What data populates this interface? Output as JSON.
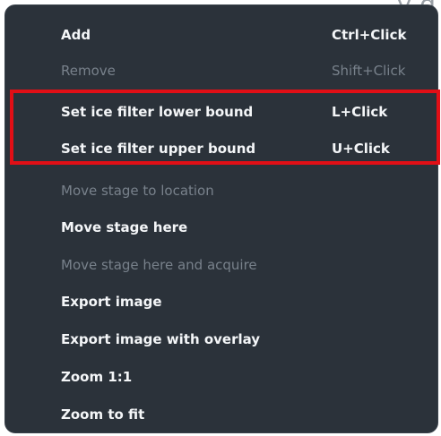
{
  "background": {
    "title_fragment": "y      g"
  },
  "menu": {
    "items": [
      {
        "label": "Add",
        "shortcut": "Ctrl+Click",
        "enabled": true
      },
      {
        "label": "Remove",
        "shortcut": "Shift+Click",
        "enabled": false
      },
      {
        "label": "Set ice filter lower bound",
        "shortcut": "L+Click",
        "enabled": true
      },
      {
        "label": "Set ice filter upper bound",
        "shortcut": "U+Click",
        "enabled": true
      },
      {
        "label": "Move stage to location",
        "shortcut": "",
        "enabled": false
      },
      {
        "label": "Move stage here",
        "shortcut": "",
        "enabled": true
      },
      {
        "label": "Move stage here and acquire",
        "shortcut": "",
        "enabled": false
      },
      {
        "label": "Export image",
        "shortcut": "",
        "enabled": true
      },
      {
        "label": "Export image with overlay",
        "shortcut": "",
        "enabled": true
      },
      {
        "label": "Zoom 1:1",
        "shortcut": "",
        "enabled": true
      },
      {
        "label": "Zoom to fit",
        "shortcut": "",
        "enabled": true
      }
    ]
  },
  "colors": {
    "menu_background": "#2b323a",
    "enabled_text": "#f4f6f8",
    "disabled_text": "#78818b",
    "highlight_border": "#e10f16"
  }
}
